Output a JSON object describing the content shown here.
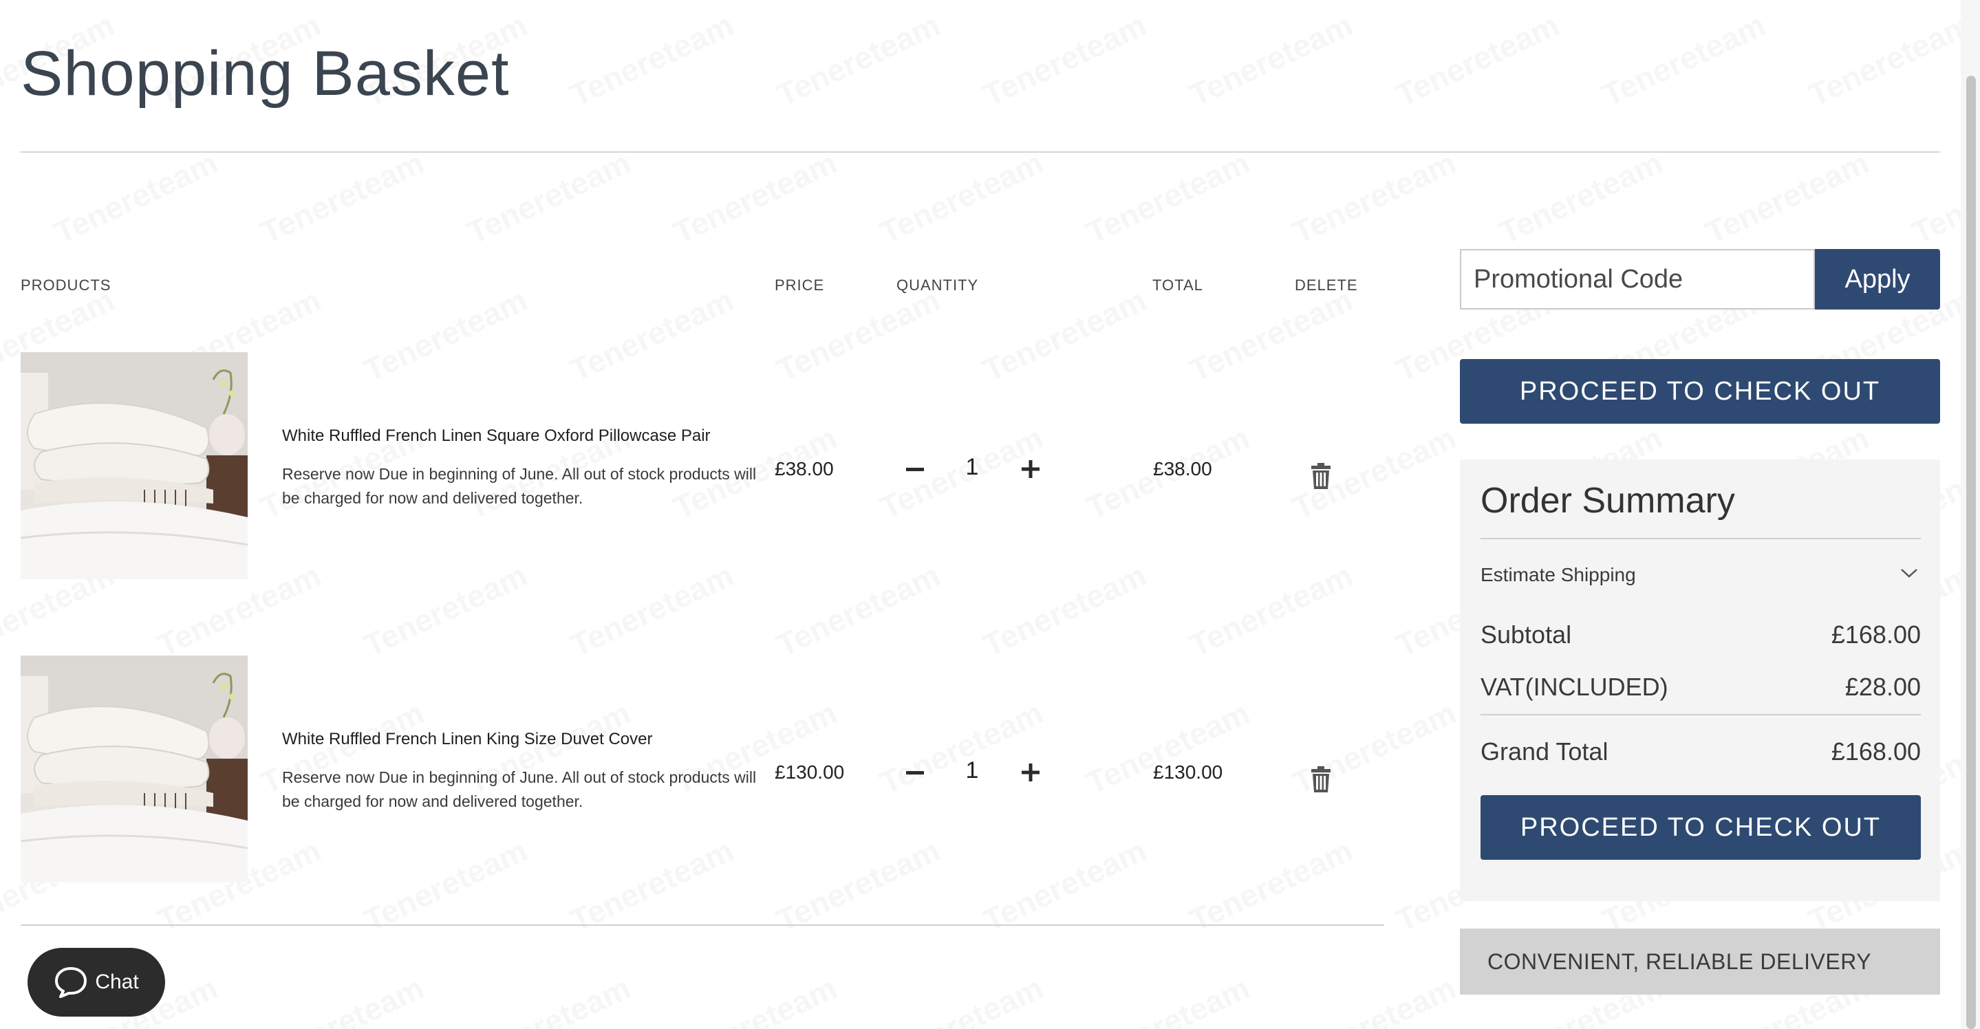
{
  "page": {
    "title": "Shopping Basket",
    "watermark_text": "Tenereteam"
  },
  "columns": {
    "products": "PRODUCTS",
    "price": "PRICE",
    "quantity": "QUANTITY",
    "total": "TOTAL",
    "delete": "DELETE"
  },
  "items": [
    {
      "name": "White Ruffled French Linen Square Oxford Pillowcase Pair",
      "note": "Reserve now Due in beginning of June. All out of stock products will be charged for now and delivered together.",
      "price": "£38.00",
      "quantity": "1",
      "total": "£38.00",
      "decrease_icon": "minus-icon",
      "increase_icon": "plus-icon",
      "delete_icon": "trash-icon"
    },
    {
      "name": "White Ruffled French Linen King Size Duvet Cover",
      "note": "Reserve now Due in beginning of June. All out of stock products will be charged for now and delivered together.",
      "price": "£130.00",
      "quantity": "1",
      "total": "£130.00",
      "decrease_icon": "minus-icon",
      "increase_icon": "plus-icon",
      "delete_icon": "trash-icon"
    }
  ],
  "promo": {
    "placeholder": "Promotional Code",
    "apply_label": "Apply"
  },
  "checkout": {
    "top_label": "PROCEED TO CHECK OUT",
    "bottom_label": "PROCEED TO CHECK OUT"
  },
  "summary": {
    "title": "Order Summary",
    "shipping_label": "Estimate Shipping",
    "subtotal_label": "Subtotal",
    "subtotal_value": "£168.00",
    "vat_label": "VAT(INCLUDED)",
    "vat_value": "£28.00",
    "grand_total_label": "Grand Total",
    "grand_total_value": "£168.00"
  },
  "delivery": {
    "label": "CONVENIENT, RELIABLE DELIVERY"
  },
  "chat": {
    "label": "Chat",
    "icon": "chat-bubble-icon"
  },
  "colors": {
    "accent": "#2e4a72",
    "title": "#3b4550",
    "summary_bg": "#f4f4f4",
    "delivery_bg": "#d2d2d2",
    "chat_bg": "#2c2c2c"
  }
}
